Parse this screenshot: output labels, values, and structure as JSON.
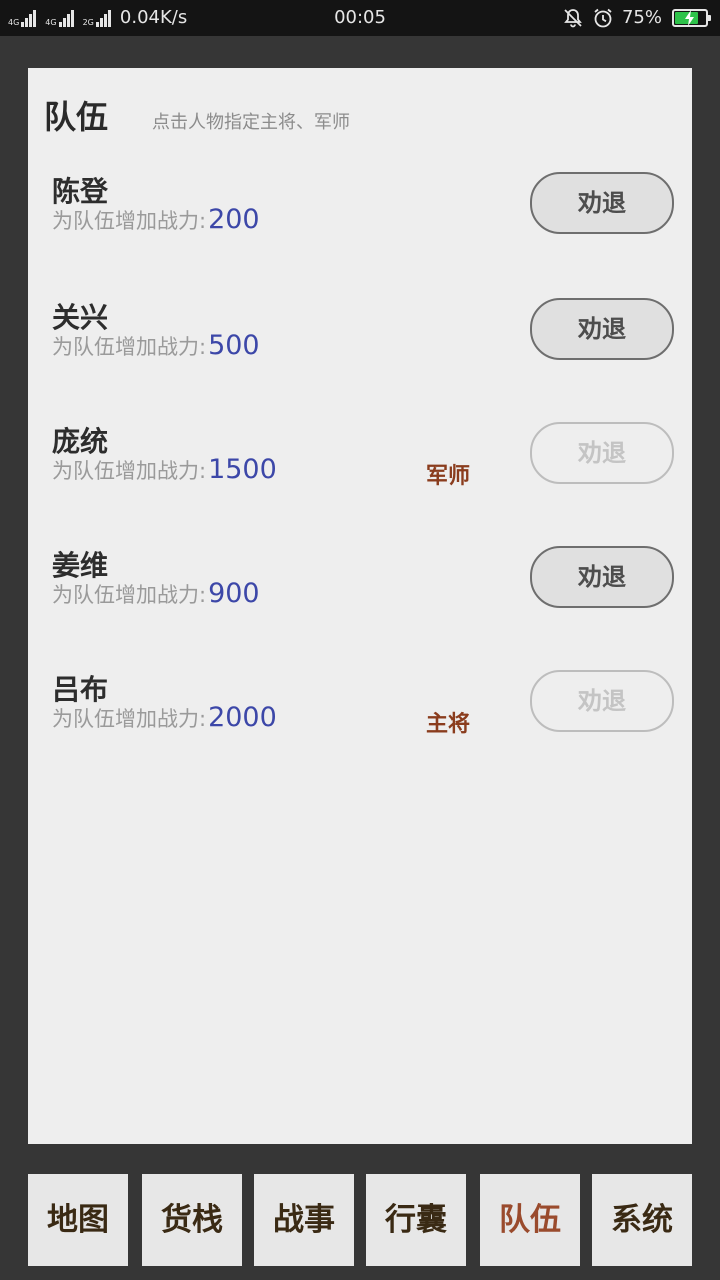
{
  "status_bar": {
    "network_1": "4G",
    "network_2": "4G",
    "network_3": "2G",
    "speed": "0.04K/s",
    "time": "00:05",
    "battery_percent": "75%",
    "battery_level": 0.75,
    "icons": [
      "bell-off-icon",
      "alarm-icon",
      "battery-charging-icon"
    ]
  },
  "panel": {
    "title": "队伍",
    "hint": "点击人物指定主将、军师"
  },
  "members": [
    {
      "name": "陈登",
      "power_label": "为队伍增加战力:",
      "power": "200",
      "role": "",
      "action": "劝退",
      "enabled": true
    },
    {
      "name": "关兴",
      "power_label": "为队伍增加战力:",
      "power": "500",
      "role": "",
      "action": "劝退",
      "enabled": true
    },
    {
      "name": "庞统",
      "power_label": "为队伍增加战力:",
      "power": "1500",
      "role": "军师",
      "action": "劝退",
      "enabled": false
    },
    {
      "name": "姜维",
      "power_label": "为队伍增加战力:",
      "power": "900",
      "role": "",
      "action": "劝退",
      "enabled": true
    },
    {
      "name": "吕布",
      "power_label": "为队伍增加战力:",
      "power": "2000",
      "role": "主将",
      "action": "劝退",
      "enabled": false
    }
  ],
  "nav": [
    {
      "label": "地图",
      "active": false
    },
    {
      "label": "货栈",
      "active": false
    },
    {
      "label": "战事",
      "active": false
    },
    {
      "label": "行囊",
      "active": false
    },
    {
      "label": "队伍",
      "active": true
    },
    {
      "label": "系统",
      "active": false
    }
  ],
  "colors": {
    "background": "#363636",
    "panel": "#eeeeee",
    "power_value": "#3c47a8",
    "role_text": "#8a3c1d",
    "nav_active": "#9a4b2d",
    "battery_fill": "#2ec24a"
  }
}
